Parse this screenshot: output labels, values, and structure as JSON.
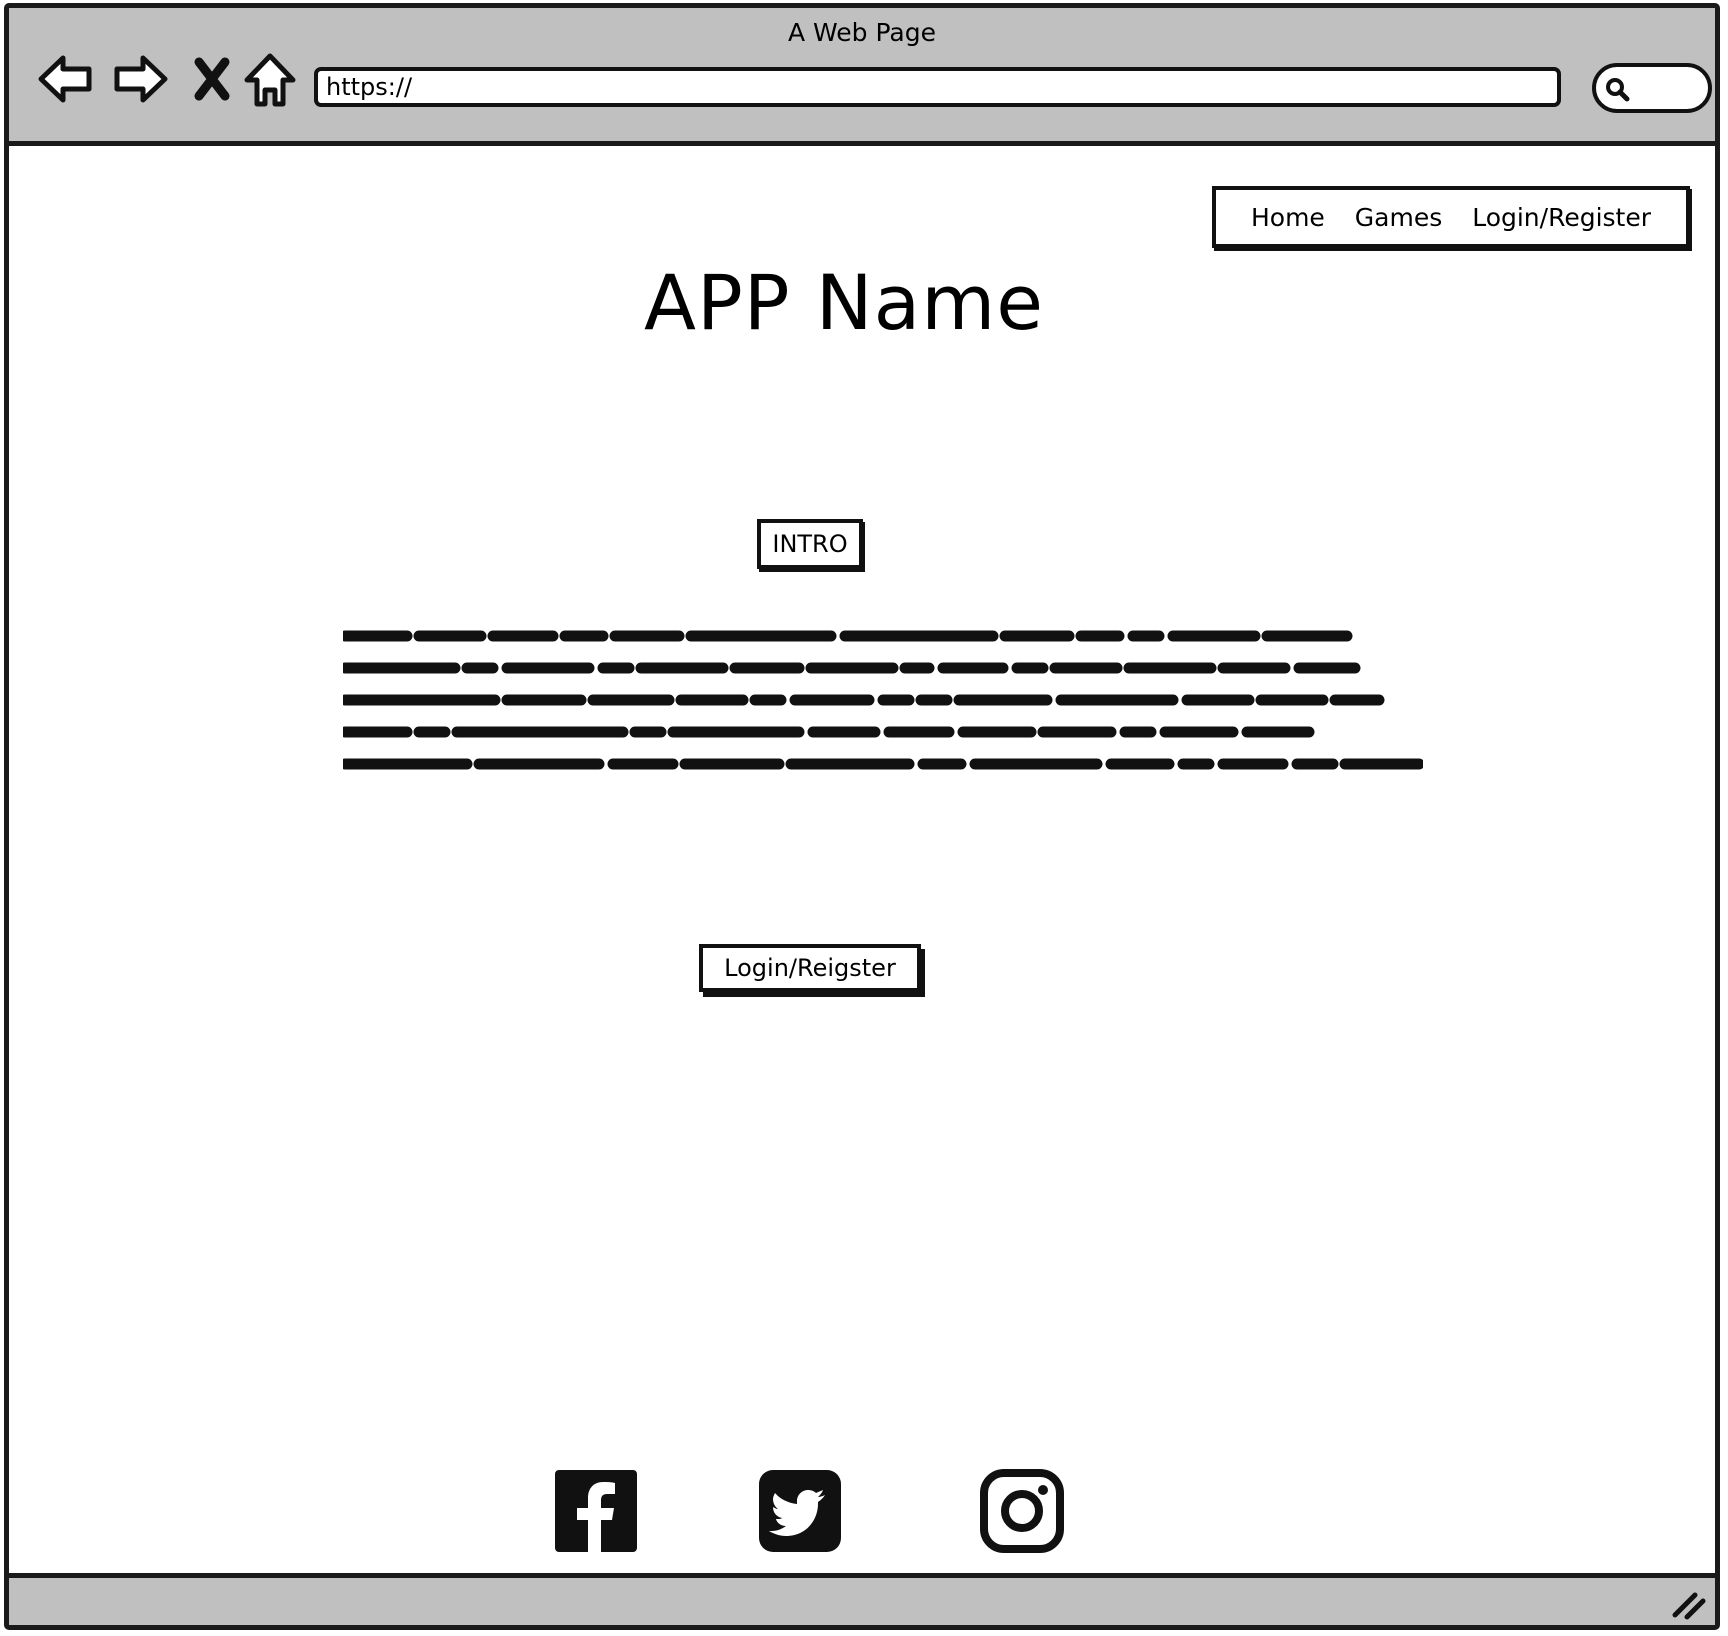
{
  "browser": {
    "title": "A Web Page",
    "url": "https://",
    "search_placeholder": ""
  },
  "nav": {
    "items": [
      "Home",
      "Games",
      "Login/Register"
    ]
  },
  "main": {
    "app_name": "APP Name",
    "intro_label": "INTRO",
    "login_button": "Login/Reigster"
  },
  "footer": {
    "social_icons": [
      "facebook-icon",
      "twitter-icon",
      "instagram-icon"
    ]
  },
  "colors": {
    "chrome": "#c0c0c0",
    "ink": "#111111",
    "background": "#ffffff"
  }
}
